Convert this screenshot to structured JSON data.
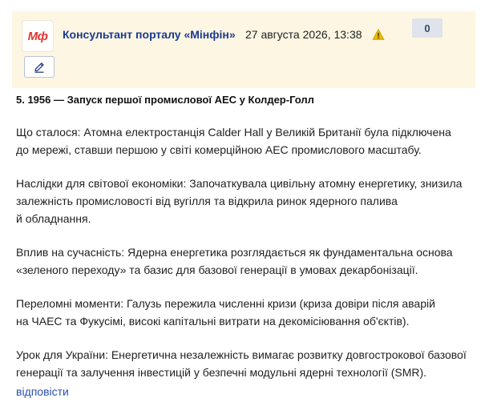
{
  "post": {
    "logo_text": "Мф",
    "author": "Консультант порталу «Мінфін»",
    "datetime": "27 августа 2026, 13:38",
    "rating": "0",
    "title": "5. 1956 — Запуск першої промислової АЕС у Колдер-Голл",
    "paragraphs": [
      {
        "lines": [
          "Що сталося: Атомна електростанція Calder Hall у Великій Британії була підключена",
          "до мережі, ставши першою у світі комерційною АЕС промислового масштабу."
        ]
      },
      {
        "lines": [
          "Наслідки для світової економіки: Започаткувала цивільну атомну енергетику, знизила",
          "залежність промисловості від вугілля та відкрила ринок ядерного палива",
          "й обладнання."
        ]
      },
      {
        "lines": [
          "Вплив на сучасність: Ядерна енергетика розглядається як фундаментальна основа",
          "«зеленого переходу» та базис для базової генерації в умовах декарбонізації."
        ]
      },
      {
        "lines": [
          "Переломні моменти: Галузь пережила численні кризи (криза довіри після аварій",
          "на ЧАЕС та Фукусімі, високі капітальні витрати на декомісіювання об'єктів)."
        ]
      },
      {
        "lines": [
          "Урок для України: Енергетична незалежність вимагає розвитку довгострокової базової",
          "генерації та залучення інвестицій у безпечні модульні ядерні технології (SMR)."
        ]
      }
    ],
    "reply_label": "відповісти"
  },
  "icons": {
    "warning": "warning-icon",
    "edit": "pencil-icon"
  },
  "colors": {
    "header_bg": "#fdf6e3",
    "author": "#1a3a8f",
    "logo": "#e3342f",
    "warning": "#e6b800",
    "link": "#2a4fb0"
  }
}
